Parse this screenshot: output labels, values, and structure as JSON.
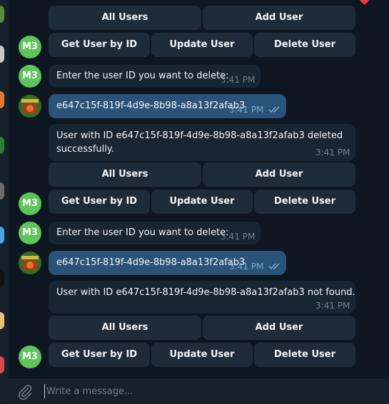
{
  "keyboard": {
    "all_users": "All Users",
    "add_user": "Add User",
    "get_user": "Get User by ID",
    "update_user": "Update User",
    "delete_user": "Delete User"
  },
  "avatars": {
    "bot_initials": "M3"
  },
  "messages": [
    {
      "text": "Enter the user ID you want to delete:",
      "time": "3:41 PM"
    },
    {
      "text": "e647c15f-819f-4d9e-8b98-a8a13f2afab3",
      "time": "3:41 PM"
    },
    {
      "text": "User with ID e647c15f-819f-4d9e-8b98-a8a13f2afab3 deleted",
      "text2": "successfully.",
      "time": "3:41 PM"
    },
    {
      "text": "Enter the user ID you want to delete:",
      "time": "3:41 PM"
    },
    {
      "text": "e647c15f-819f-4d9e-8b98-a8a13f2afab3",
      "time": "3:41 PM"
    },
    {
      "text": "User with ID e647c15f-819f-4d9e-8b98-a8a13f2afab3 not found.",
      "time": "3:41 PM"
    }
  ],
  "composer": {
    "placeholder": "Write a message..."
  },
  "colors": {
    "background": "#0e1621",
    "incoming": "#182533",
    "outgoing": "#2b5278",
    "bot_avatar": "#5ec45b",
    "button": "#1e2c3a"
  }
}
